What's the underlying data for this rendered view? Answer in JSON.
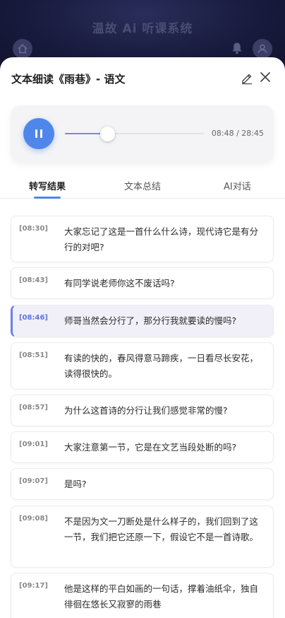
{
  "background_app": {
    "title": "温故 Ai 听课系统"
  },
  "sheet": {
    "title": "文本细读《雨巷》- 语文"
  },
  "player": {
    "time_display": "08:48 / 28:45",
    "progress": 0.306
  },
  "tabs": [
    {
      "label": "转写结果",
      "active": true
    },
    {
      "label": "文本总结",
      "active": false
    },
    {
      "label": "AI对话",
      "active": false
    }
  ],
  "transcript": [
    {
      "time": "[08:30]",
      "text": "大家忘记了这是一首什么什么诗，现代诗它是有分行的对吧?",
      "active": false
    },
    {
      "time": "[08:43]",
      "text": "有同学说老师你这不废话吗?",
      "active": false
    },
    {
      "time": "[08:46]",
      "text": "师哥当然会分行了，那分行我就要读的慢吗?",
      "active": true
    },
    {
      "time": "[08:51]",
      "text": "有读的快的，春风得意马蹄疾，一日看尽长安花，读得很快的。",
      "active": false
    },
    {
      "time": "[08:57]",
      "text": "为什么这首诗的分行让我们感觉非常的慢?",
      "active": false
    },
    {
      "time": "[09:01]",
      "text": "大家注意第一节，它是在文艺当段处断的吗?",
      "active": false
    },
    {
      "time": "[09:07]",
      "text": "是吗?",
      "active": false
    },
    {
      "time": "[09:08]",
      "text": "不是因为文一刀断处是什么样子的，我们回到了这一节，我们把它还原一下，假设它不是一首诗歌。",
      "active": false
    },
    {
      "time": "[09:17]",
      "text": "他是这样的平白如画的一句话，撑着油纸伞，独自徘徊在悠长又寂寥的雨巷",
      "active": false
    }
  ],
  "colors": {
    "accent": "#4f86ec",
    "active_entry_bg": "#f1eff8",
    "active_border": "#6a7fe6"
  },
  "icons": [
    "home-icon",
    "bell-icon",
    "user-icon",
    "edit-icon",
    "close-icon",
    "pause-icon"
  ]
}
